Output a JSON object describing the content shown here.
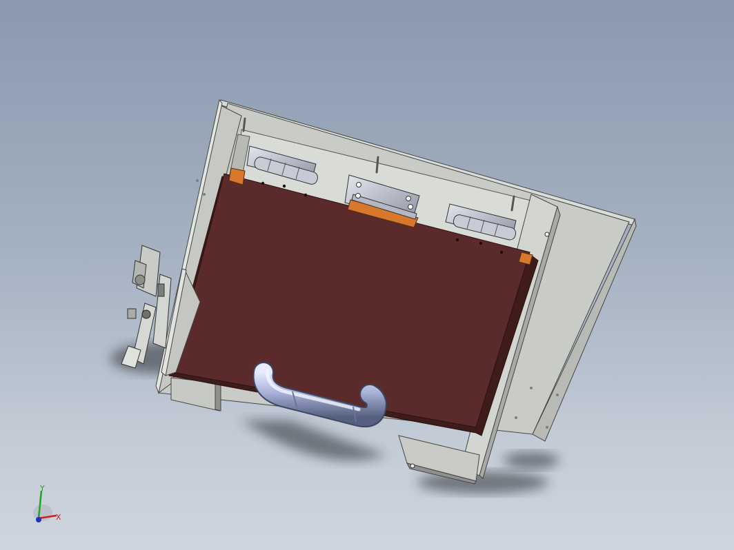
{
  "viewport": {
    "background_top": "#8a99ae",
    "background_bottom": "#cfd5de"
  },
  "model": {
    "description_icon": "cad-assembly-icon",
    "colors": {
      "frame": "#c9cbc7",
      "frame_dark": "#9d9f9c",
      "panel": "#5b2b2b",
      "panel_edge": "#3f1c1c",
      "hinge_metal": "#b9bcc6",
      "handle_metal": "#a9b2d8",
      "orange_pad": "#d8782c"
    }
  },
  "triad": {
    "x_label": "X",
    "y_label": "Y",
    "x_color": "#d11f1f",
    "y_color": "#1fa51f",
    "z_color": "#2030c0"
  }
}
